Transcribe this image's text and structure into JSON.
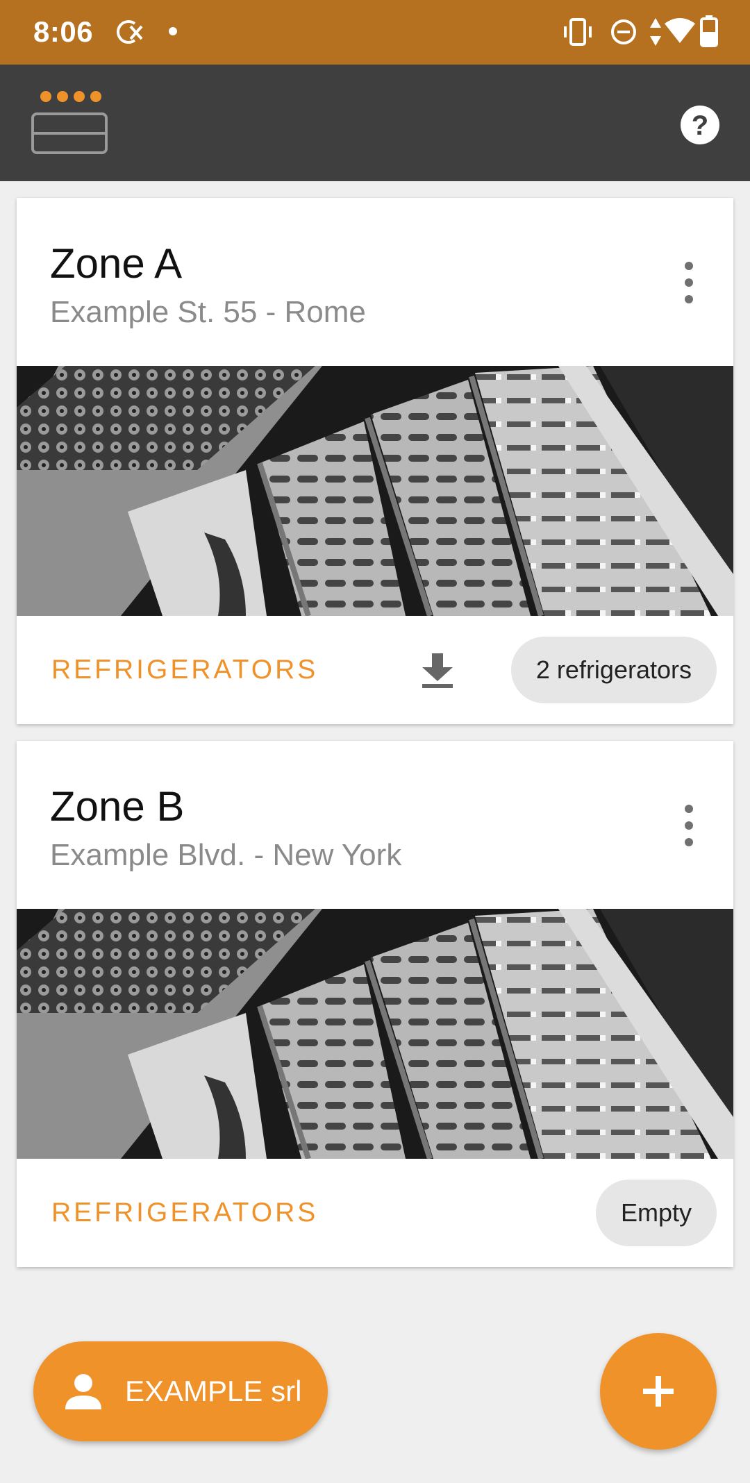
{
  "status_bar": {
    "time": "8:06",
    "icons": [
      "sync-disabled-icon",
      "dot-icon",
      "vibrate-icon",
      "do-not-disturb-icon",
      "data-arrows-icon",
      "wifi-icon",
      "battery-icon"
    ]
  },
  "toolbar": {
    "menu_icon": "menu-icon",
    "help_icon": "help-icon"
  },
  "zones": [
    {
      "title": "Zone A",
      "address": "Example St. 55 - Rome",
      "link_label": "REFRIGERATORS",
      "chip": "2 refrigerators",
      "has_download": true
    },
    {
      "title": "Zone B",
      "address": "Example Blvd. - New York",
      "link_label": "REFRIGERATORS",
      "chip": "Empty",
      "has_download": false
    }
  ],
  "account_fab": {
    "label": "EXAMPLE srl",
    "icon": "person-icon"
  },
  "add_fab": {
    "icon": "plus-icon"
  },
  "colors": {
    "status_bar": "#b5711f",
    "toolbar": "#3f3f3f",
    "accent": "#f0922a",
    "background": "#efefef"
  }
}
